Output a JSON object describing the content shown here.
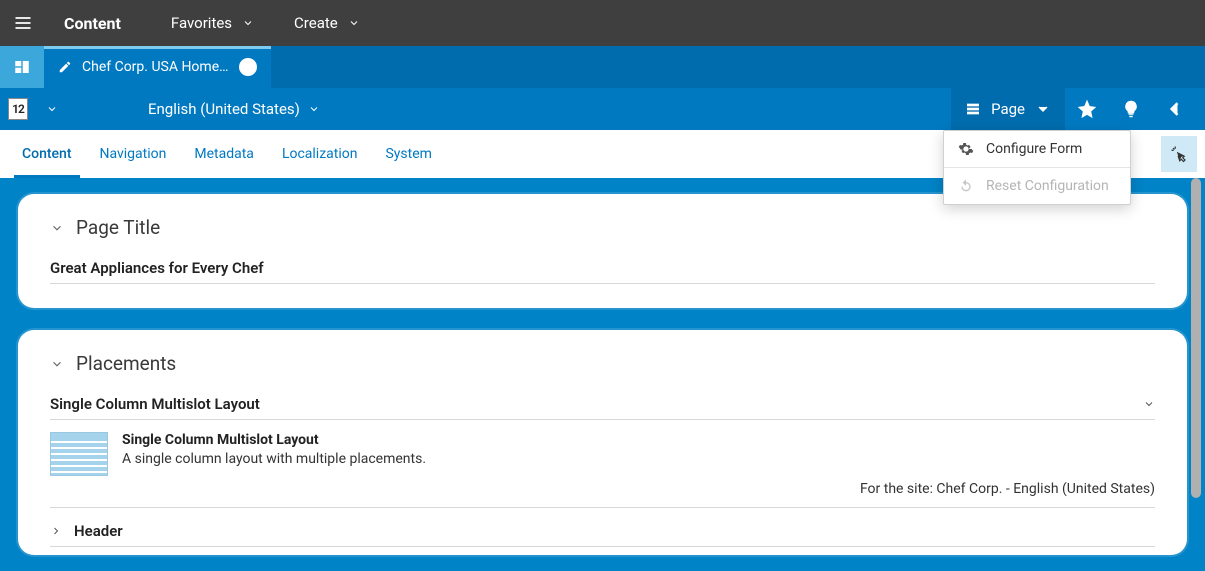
{
  "topbar": {
    "content_label": "Content",
    "favorites_label": "Favorites",
    "create_label": "Create"
  },
  "tabs": {
    "active": "Chef Corp. USA Home…"
  },
  "contextbar": {
    "layout_code": "12",
    "language": "English (United States)",
    "page_button": "Page"
  },
  "page_menu": {
    "configure_form": "Configure Form",
    "reset_configuration": "Reset Configuration"
  },
  "subtabs": {
    "content": "Content",
    "navigation": "Navigation",
    "metadata": "Metadata",
    "localization": "Localization",
    "system": "System"
  },
  "sections": {
    "page_title": {
      "heading": "Page Title",
      "value": "Great Appliances for Every Chef"
    },
    "placements": {
      "heading": "Placements",
      "layout_selector": "Single Column Multislot Layout",
      "layout": {
        "name": "Single Column Multislot Layout",
        "description": "A single column layout with multiple placements.",
        "site_note": "For the site: Chef Corp. - English (United States)"
      },
      "header_label": "Header"
    }
  }
}
